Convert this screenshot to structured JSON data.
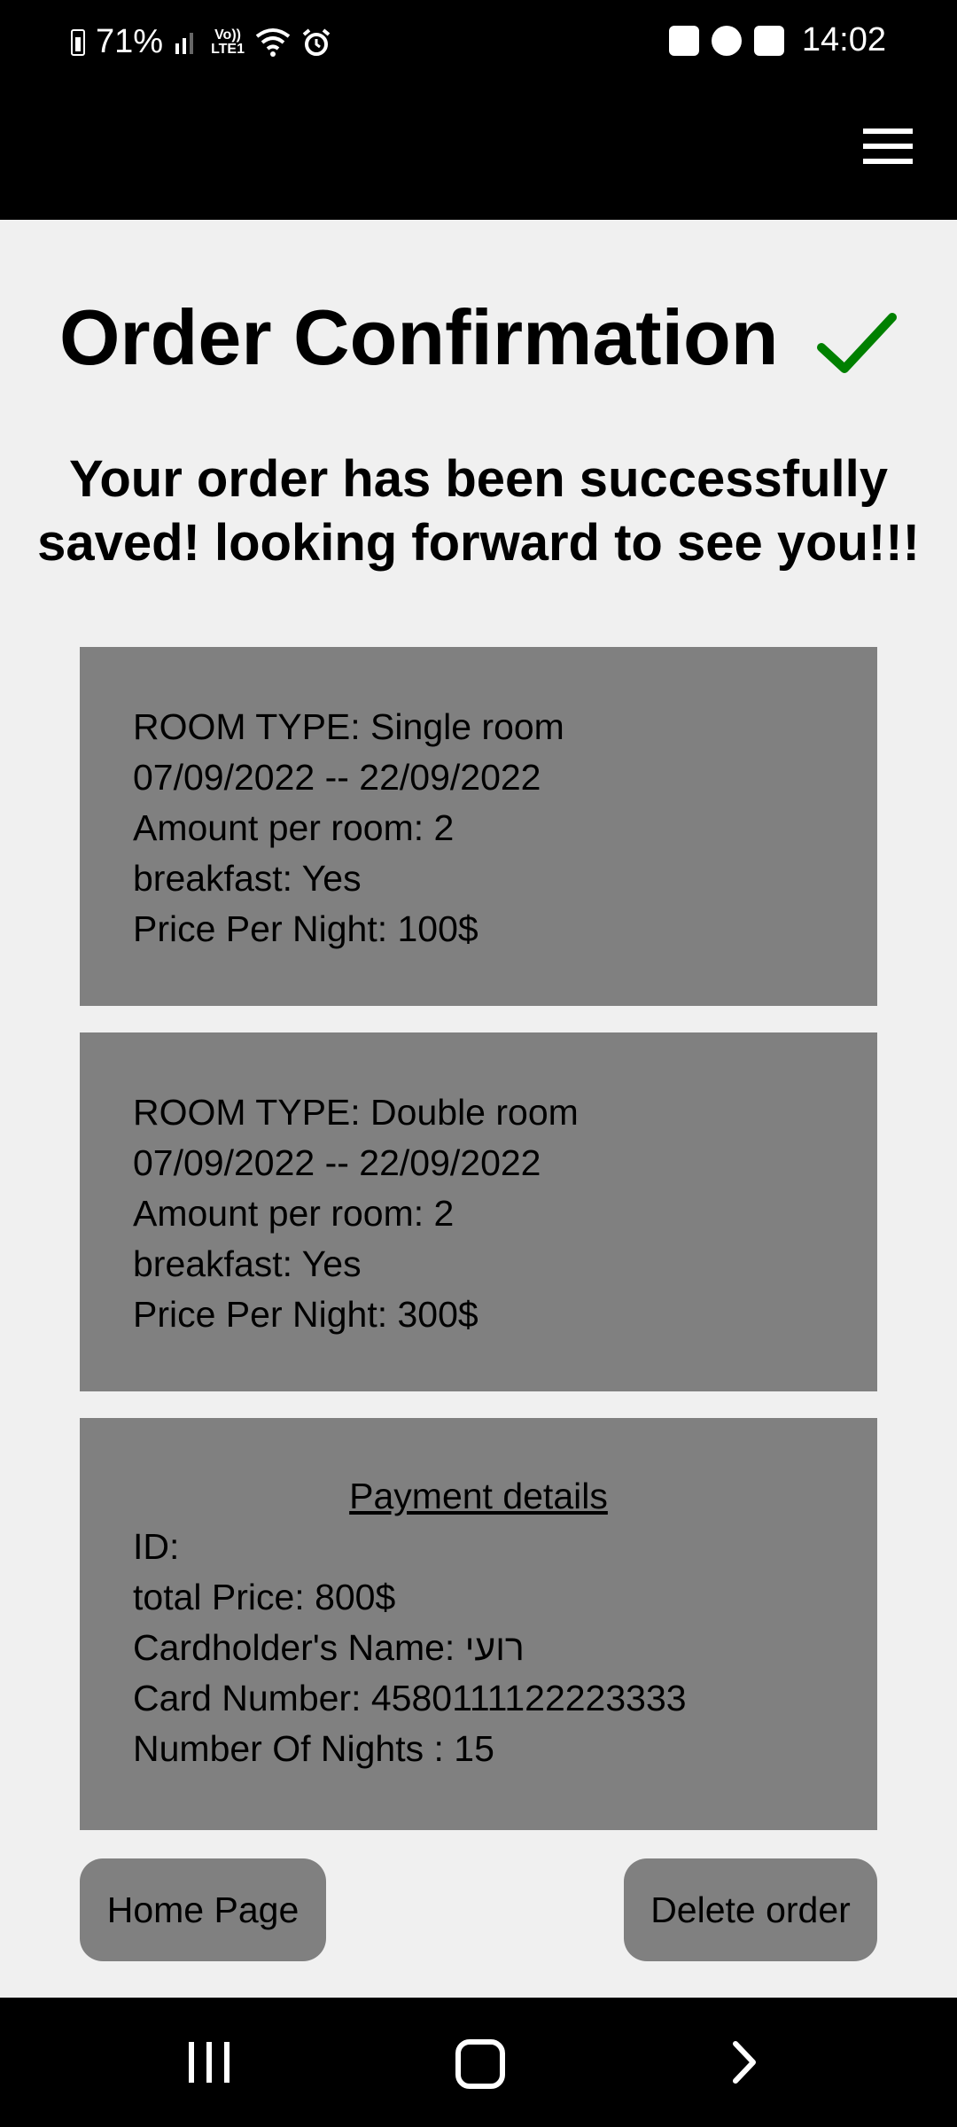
{
  "status_bar": {
    "battery": "71%",
    "time": "14:02",
    "lte_top": "Vo))",
    "lte_bottom": "LTE1",
    "icons": [
      "battery-icon",
      "signal-icon",
      "volte-icon",
      "wifi-icon",
      "alarm-icon",
      "shopping-bag-icon",
      "arrow-up-circle-icon",
      "gallery-icon"
    ]
  },
  "header": {
    "menu_icon": "hamburger-icon"
  },
  "page": {
    "title": "Order Confirmation",
    "title_icon": "check-icon",
    "check_color": "#008000",
    "subtitle": "Your order has been successfully saved! looking forward to see you!!!"
  },
  "rooms": [
    {
      "room_type": "ROOM TYPE: Single room",
      "dates": "07/09/2022 -- 22/09/2022",
      "amount": "Amount per room: 2",
      "breakfast": "breakfast: Yes",
      "price": "Price Per Night: 100$"
    },
    {
      "room_type": "ROOM TYPE: Double room",
      "dates": "07/09/2022 -- 22/09/2022",
      "amount": "Amount per room: 2",
      "breakfast": "breakfast: Yes",
      "price": "Price Per Night: 300$"
    }
  ],
  "payment": {
    "title": "Payment details",
    "id": "ID:",
    "total_price": "total Price: 800$",
    "cardholder": "Cardholder's Name: רועי",
    "card_number": "Card Number: 4580111122223333",
    "nights": "Number Of Nights : 15"
  },
  "buttons": {
    "home": "Home Page",
    "delete": "Delete order"
  },
  "colors": {
    "card_bg": "#808080",
    "page_bg": "#f0f0f0",
    "bar_bg": "#000000"
  }
}
